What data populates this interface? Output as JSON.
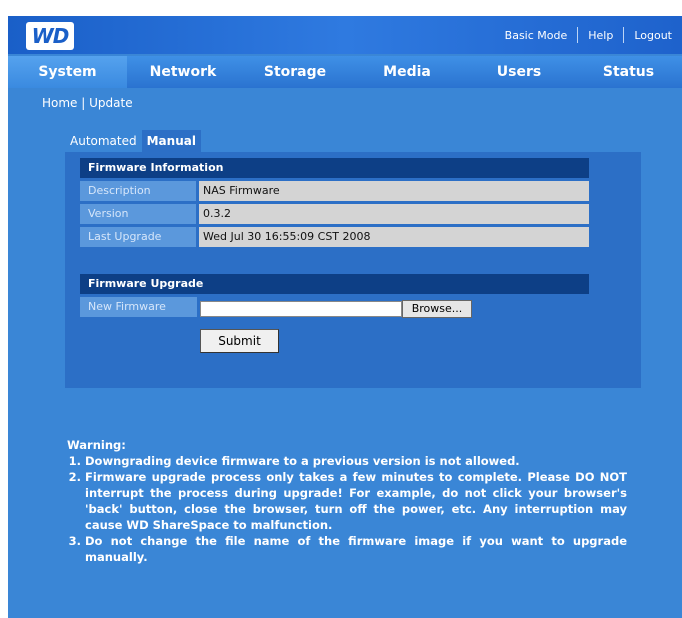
{
  "header": {
    "logo_text": "WD",
    "links": [
      "Basic Mode",
      "Help",
      "Logout"
    ]
  },
  "nav": {
    "tabs": [
      "System",
      "Network",
      "Storage",
      "Media",
      "Users",
      "Status"
    ],
    "active": "System"
  },
  "breadcrumb": {
    "home": "Home",
    "separator": "|",
    "current": "Update"
  },
  "subtabs": {
    "items": [
      "Automated",
      "Manual"
    ],
    "active": "Manual"
  },
  "firmware_info": {
    "heading": "Firmware Information",
    "rows": [
      {
        "label": "Description",
        "value": "NAS Firmware"
      },
      {
        "label": "Version",
        "value": "0.3.2"
      },
      {
        "label": "Last Upgrade",
        "value": "Wed Jul 30 16:55:09 CST 2008"
      }
    ]
  },
  "firmware_upgrade": {
    "heading": "Firmware Upgrade",
    "new_firmware_label": "New Firmware",
    "file_value": "",
    "browse_label": "Browse...",
    "submit_label": "Submit"
  },
  "warning": {
    "title": "Warning:",
    "items": [
      "Downgrading device firmware to a previous version is not allowed.",
      "Firmware upgrade process only takes a few minutes to complete. Please DO NOT interrupt the process during upgrade! For example, do not click your browser's 'back' button, close the browser, turn off the power, etc. Any interruption may cause WD ShareSpace to malfunction.",
      "Do not change the file name of the firmware image if you want to upgrade manually."
    ]
  },
  "colors": {
    "background": "#3a86d6",
    "header": "#1a5fc8",
    "panel": "#2c6fc6",
    "section_header": "#0d3f86",
    "value_cell": "#d4d4d4"
  }
}
